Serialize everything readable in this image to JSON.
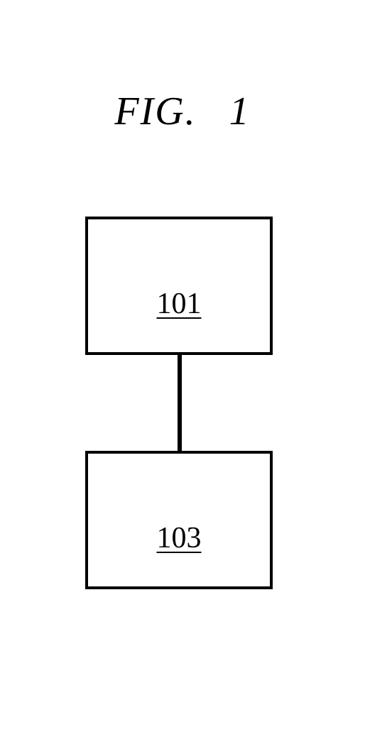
{
  "title": {
    "prefix": "FIG.",
    "number": "1"
  },
  "boxes": {
    "top": {
      "label": "101"
    },
    "bottom": {
      "label": "103"
    }
  }
}
